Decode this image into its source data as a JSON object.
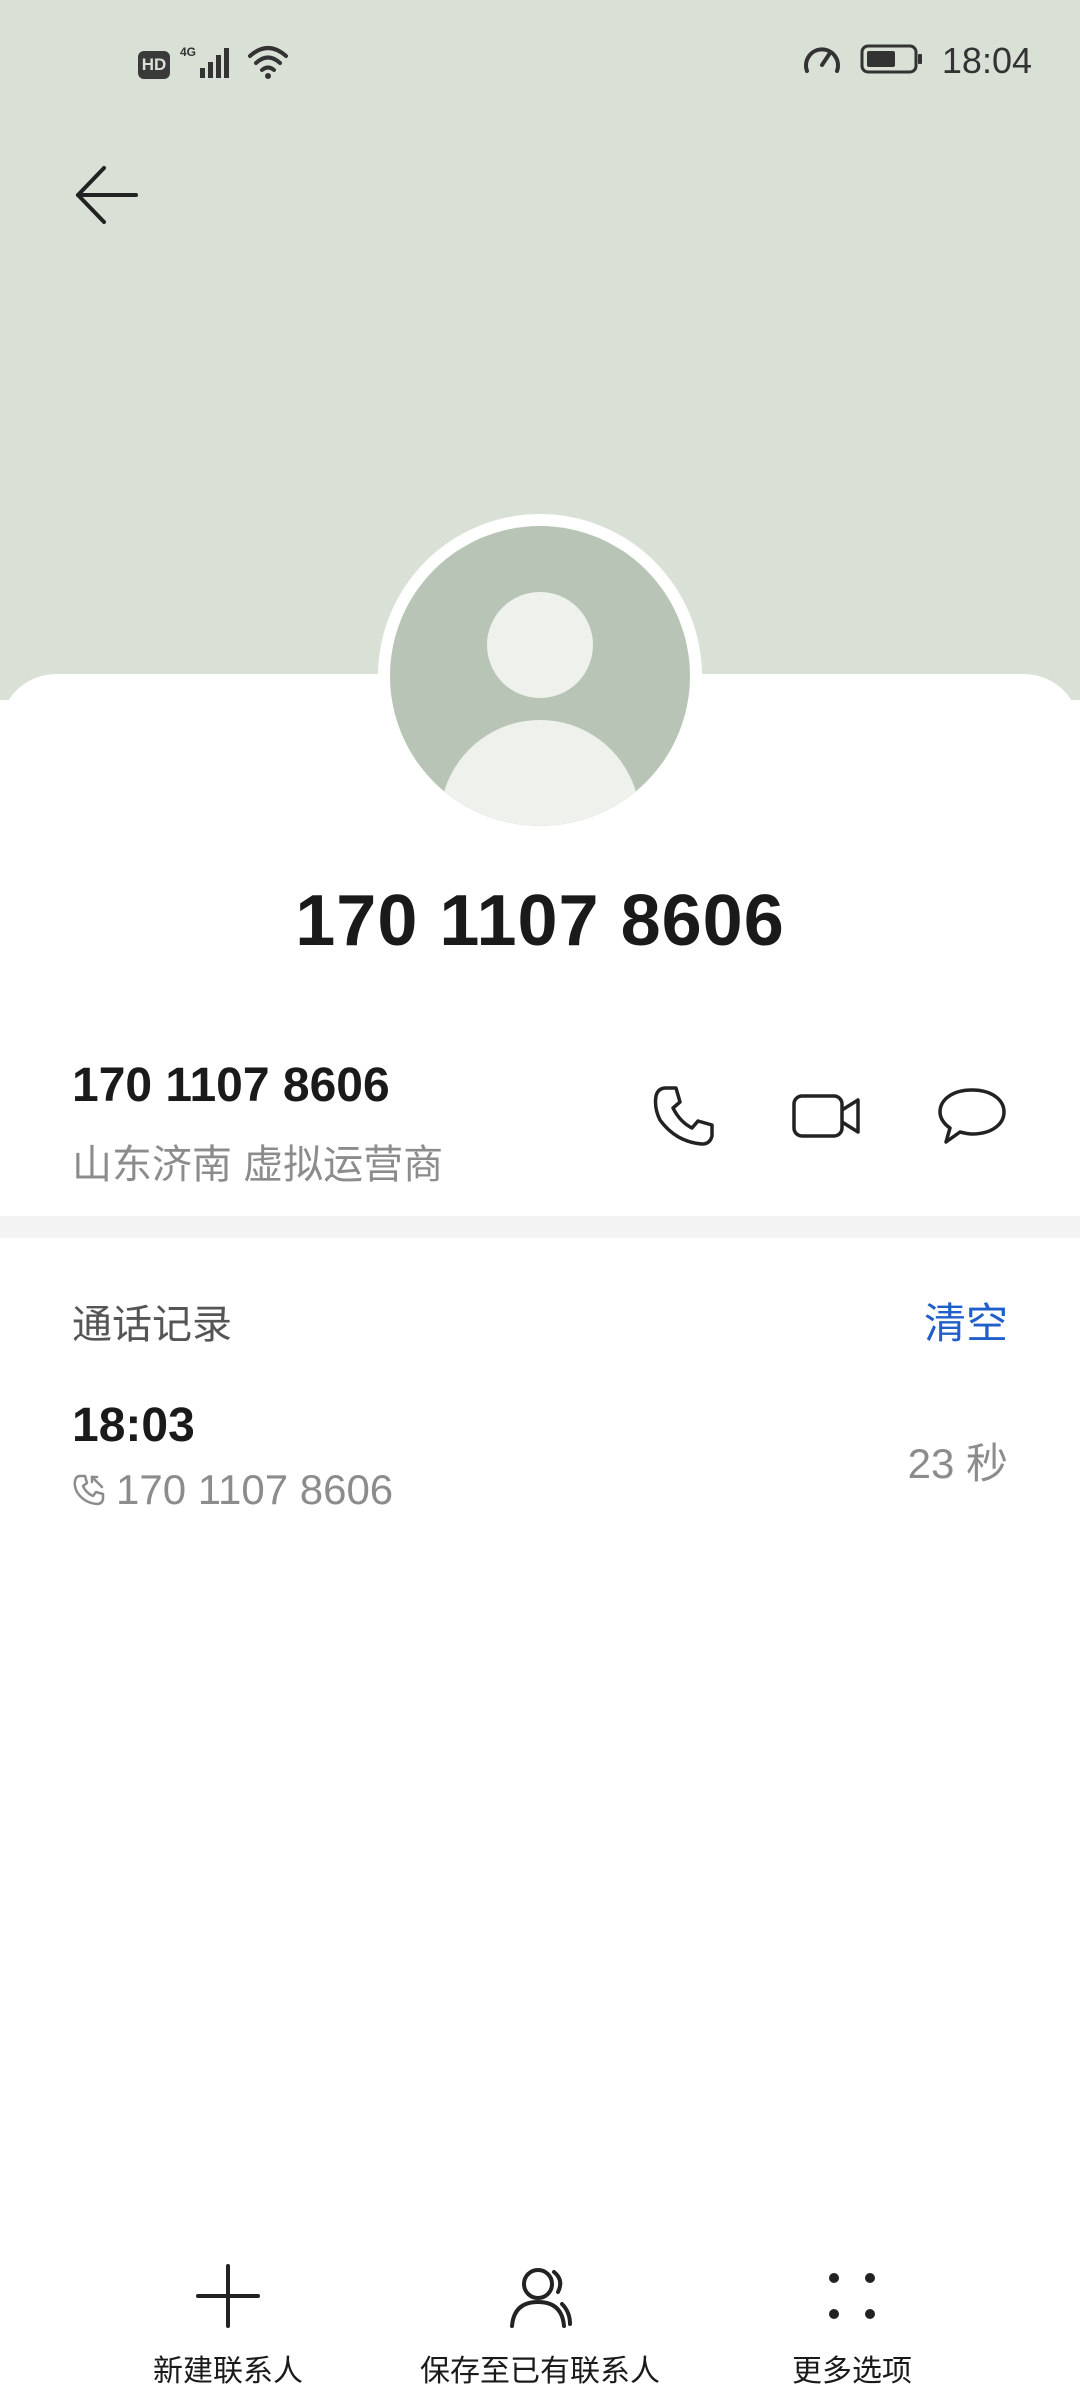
{
  "status_bar": {
    "network_badge": "HD",
    "network_type": "4G",
    "time": "18:04",
    "icons": [
      "hd-icon",
      "signal-4g-icon",
      "wifi-icon",
      "speedometer-icon",
      "battery-icon"
    ]
  },
  "header": {
    "back_icon": "arrow-left-icon",
    "title_number": "170 1107 8606"
  },
  "phone_entry": {
    "number": "170 1107 8606",
    "location": "山东济南 虚拟运营商",
    "actions": [
      "phone-call-icon",
      "video-call-icon",
      "message-icon"
    ]
  },
  "call_log": {
    "section_title": "通话记录",
    "clear_label": "清空",
    "entries": [
      {
        "time": "18:03",
        "number": "170 1107 8606",
        "duration": "23 秒",
        "direction_icon": "incoming-call-icon"
      }
    ]
  },
  "bottom_bar": {
    "items": [
      {
        "label": "新建联系人",
        "icon": "plus-icon"
      },
      {
        "label": "保存至已有联系人",
        "icon": "person-icon"
      },
      {
        "label": "更多选项",
        "icon": "more-dots-icon"
      }
    ]
  },
  "colors": {
    "header_bg": "#d9e1d6",
    "avatar_bg": "#b8c5b6",
    "accent": "#1f5fc8",
    "secondary_text": "#8c8c8c"
  }
}
